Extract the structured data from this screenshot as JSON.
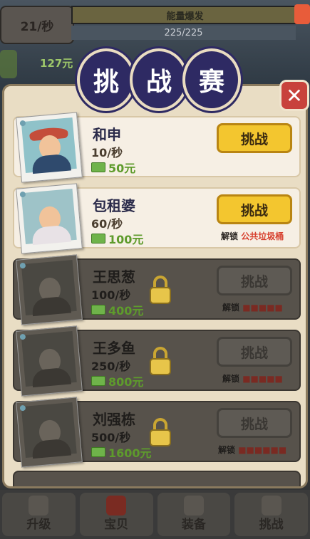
{
  "hud": {
    "income_rate": "21/秒",
    "energy_label": "能量爆发",
    "energy_count": "225/225",
    "floating_money": "127元"
  },
  "title": {
    "chars": [
      "挑",
      "战",
      "赛"
    ]
  },
  "close_label": "✕",
  "opponents": [
    {
      "name": "和申",
      "rate": "10/秒",
      "reward": "50元",
      "button": "挑战",
      "locked": false,
      "unlock_prefix": "",
      "unlock_target": ""
    },
    {
      "name": "包租婆",
      "rate": "60/秒",
      "reward": "100元",
      "button": "挑战",
      "locked": false,
      "unlock_prefix": "解锁",
      "unlock_target": "公共垃圾桶"
    },
    {
      "name": "王思葱",
      "rate": "100/秒",
      "reward": "400元",
      "button": "挑战",
      "locked": true,
      "unlock_prefix": "解锁",
      "unlock_target": "■■■■■"
    },
    {
      "name": "王多鱼",
      "rate": "250/秒",
      "reward": "800元",
      "button": "挑战",
      "locked": true,
      "unlock_prefix": "解锁",
      "unlock_target": "■■■■■"
    },
    {
      "name": "刘强栋",
      "rate": "500/秒",
      "reward": "1600元",
      "button": "挑战",
      "locked": true,
      "unlock_prefix": "解锁",
      "unlock_target": "■■■■■■"
    }
  ],
  "bottom_nav": [
    {
      "label": "升级",
      "icon": "muscle-arm-icon"
    },
    {
      "label": "宝贝",
      "icon": "trash-can-icon"
    },
    {
      "label": "装备",
      "icon": "gloves-icon"
    },
    {
      "label": "挑战",
      "icon": "fist-icon"
    }
  ],
  "colors": {
    "title_circle": "#2e2a63",
    "button_active": "#f3c62f",
    "reward_green": "#5e9b2c",
    "unlock_red": "#d7402e",
    "close_red": "#c8423c"
  }
}
